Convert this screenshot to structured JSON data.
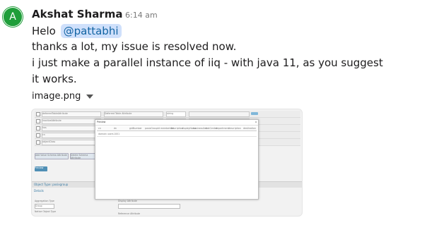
{
  "message": {
    "avatar_letter": "A",
    "author": "Akshat Sharma",
    "time": "6:14 am",
    "greeting": "Helo",
    "mention": "@pattabhi",
    "line2": "thanks a lot, my issue is resolved now.",
    "line3": "i just make a parallel instance of iiq - with java 11, as you suggest",
    "line4": "it works."
  },
  "attachment": {
    "filename": "image.png",
    "caret_icon": "caret-down-icon"
  },
  "screenshot": {
    "rows": [
      {
        "name": "deferredTableAttribute",
        "display": "Deferred Table Attribute",
        "type": "string"
      },
      {
        "name": "inactiveAttribute",
        "display": "Status Attribute",
        "type": "string"
      },
      {
        "name": "has",
        "display": "has associated with this entity",
        "type": "string"
      },
      {
        "name": "cn",
        "display": "name Identifier",
        "type": "string"
      },
      {
        "name": "objectClass",
        "display": "",
        "type": "string"
      }
    ],
    "row_action": "Edit",
    "add_button": "Add Value Schema Attribute",
    "delete_button": "Delete Schema Attribute",
    "apply_button": "Preview",
    "section_title": "Object Type: posixgroup",
    "details_label": "Details",
    "field1_label": "Aggregation Type",
    "field1_value": "Group",
    "field2_label": "Display Attribute",
    "field3_label": "Native Object Type",
    "field4_label": "Reference Attribute",
    "preview": {
      "title": "Preview",
      "close": "x",
      "columns": [
        "cn",
        "dn",
        "gidNumber",
        "posixGroupId",
        "memberUid",
        "description",
        "displayName",
        "businessUnit",
        "costCenter",
        "department",
        "description",
        "destination"
      ],
      "row": [
        "domain users",
        "1001",
        "",
        "",
        "",
        "",
        "",
        "",
        "",
        "",
        "",
        ""
      ]
    }
  }
}
